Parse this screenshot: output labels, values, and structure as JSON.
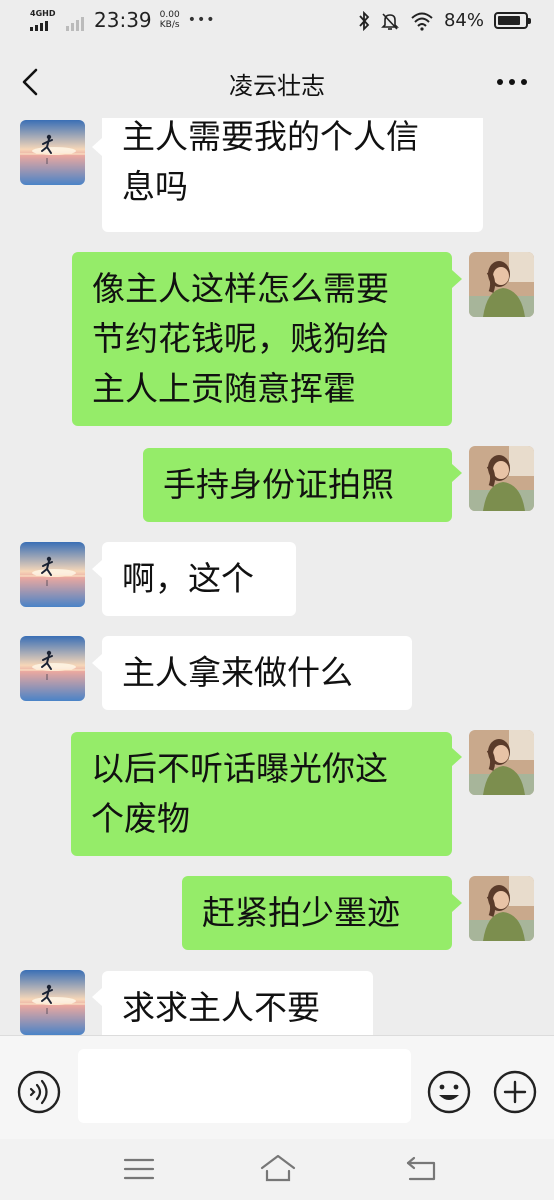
{
  "status_bar": {
    "network_label": "4GHD",
    "time": "23:39",
    "speed_value": "0.00",
    "speed_unit": "KB/s",
    "notif_dots": "•••",
    "battery_percent": "84%",
    "battery_level": 0.84
  },
  "header": {
    "title": "凌云壮志",
    "back_icon": "chevron-left-icon",
    "more_icon": "more-dots-icon"
  },
  "messages": [
    {
      "side": "left",
      "lines": [
        "主人需要我的个人信",
        "息吗"
      ]
    },
    {
      "side": "right",
      "lines": [
        "像主人这样怎么需要",
        "节约花钱呢，贱狗给",
        "主人上贡随意挥霍"
      ]
    },
    {
      "side": "right",
      "lines": [
        "手持身份证拍照"
      ]
    },
    {
      "side": "left",
      "lines": [
        "啊，这个"
      ]
    },
    {
      "side": "left",
      "lines": [
        "主人拿来做什么"
      ]
    },
    {
      "side": "right",
      "lines": [
        "以后不听话曝光你这",
        "个废物"
      ]
    },
    {
      "side": "right",
      "lines": [
        "赶紧拍少墨迹"
      ]
    },
    {
      "side": "left",
      "lines": [
        "求求主人不要"
      ]
    }
  ],
  "input_bar": {
    "voice_icon": "voice-icon",
    "input_value": "",
    "emoji_icon": "emoji-icon",
    "plus_icon": "plus-icon"
  },
  "nav_bar": {
    "menu_icon": "menu-icon",
    "home_icon": "home-icon",
    "back_icon": "back-icon"
  },
  "colors": {
    "background": "#ededed",
    "bubble_self": "#95ec69",
    "bubble_other": "#ffffff"
  }
}
